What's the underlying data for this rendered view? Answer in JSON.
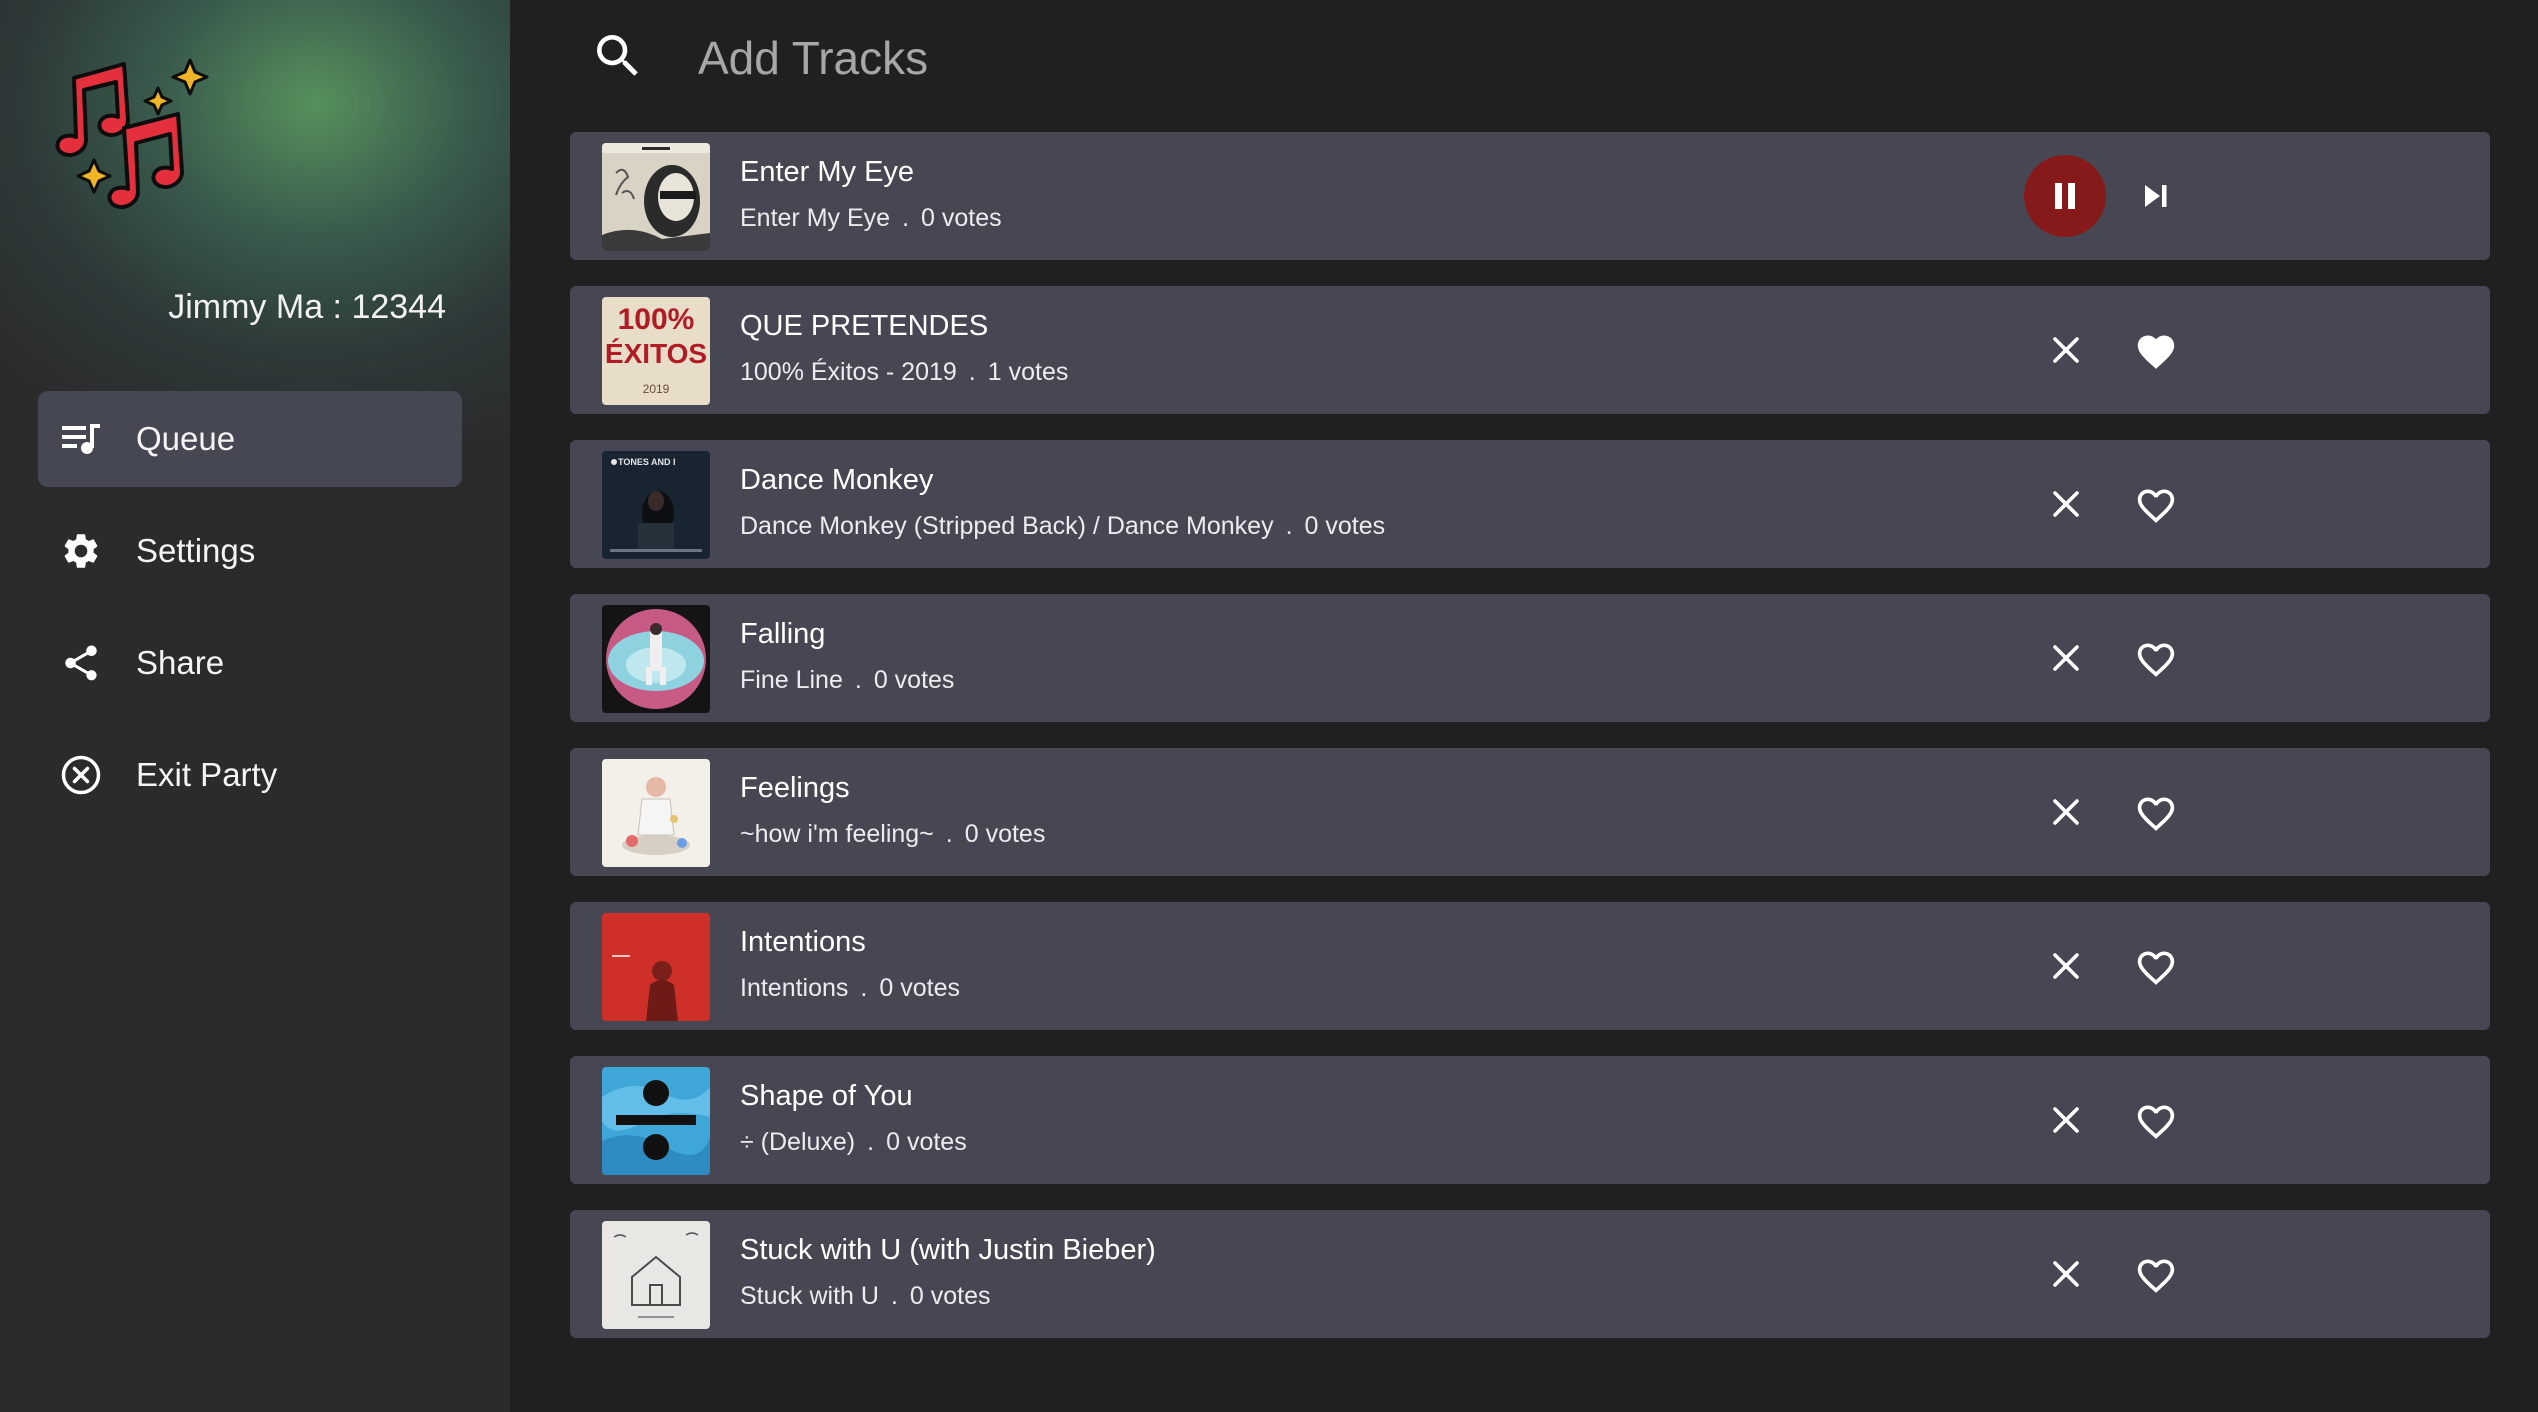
{
  "sidebar": {
    "user": "Jimmy Ma : 12344",
    "nav": [
      {
        "label": "Queue",
        "icon": "queue-music-icon",
        "active": true
      },
      {
        "label": "Settings",
        "icon": "gear-icon",
        "active": false
      },
      {
        "label": "Share",
        "icon": "share-icon",
        "active": false
      },
      {
        "label": "Exit Party",
        "icon": "close-circle-icon",
        "active": false
      }
    ]
  },
  "search": {
    "placeholder": "Add Tracks"
  },
  "tracks": [
    {
      "title": "Enter My Eye",
      "album": "Enter My Eye",
      "votes": "0 votes",
      "playing": true
    },
    {
      "title": "QUE PRETENDES",
      "album": "100% Éxitos - 2019",
      "votes": "1 votes",
      "liked": true
    },
    {
      "title": "Dance Monkey",
      "album": "Dance Monkey (Stripped Back) / Dance Monkey",
      "votes": "0 votes",
      "liked": false
    },
    {
      "title": "Falling",
      "album": "Fine Line",
      "votes": "0 votes",
      "liked": false
    },
    {
      "title": "Feelings",
      "album": "~how i'm feeling~",
      "votes": "0 votes",
      "liked": false
    },
    {
      "title": "Intentions",
      "album": "Intentions",
      "votes": "0 votes",
      "liked": false
    },
    {
      "title": "Shape of You",
      "album": "÷ (Deluxe)",
      "votes": "0 votes",
      "liked": false
    },
    {
      "title": "Stuck with U (with Justin Bieber)",
      "album": "Stuck with U",
      "votes": "0 votes",
      "liked": false
    }
  ],
  "art_text": {
    "exitos_top": "100%",
    "exitos_mid": "ÉXITOS",
    "exitos_year": "2019",
    "tones": "TONES AND I"
  },
  "colors": {
    "accent_pause": "#861a1b",
    "card": "#464753",
    "logo_notes": "#d8303a",
    "logo_sparkles": "#f0b429"
  }
}
